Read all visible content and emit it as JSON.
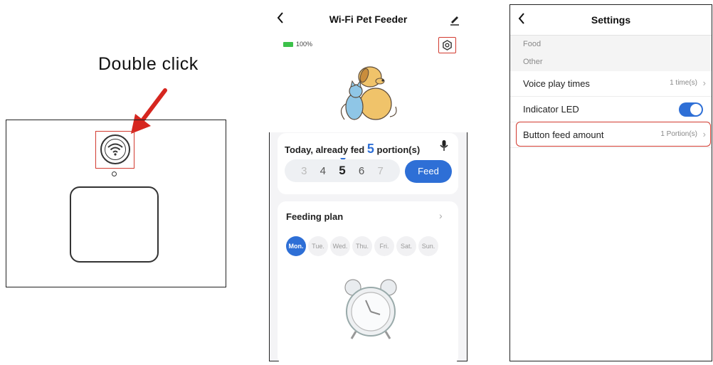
{
  "illustration": {
    "caption": "Double click",
    "arrow_color": "#d6261f",
    "highlight_color": "#d23a2f"
  },
  "feeder_screen": {
    "title": "Wi-Fi Pet Feeder",
    "back_icon": "chevron-left-icon",
    "edit_icon": "pencil-icon",
    "battery_percent": "100%",
    "fed_prefix": "Today, already fed",
    "fed_count": "5",
    "fed_suffix": "portion(s)",
    "portion_options": [
      "3",
      "4",
      "5",
      "6",
      "7"
    ],
    "portion_selected": "5",
    "feed_button": "Feed",
    "plan_title": "Feeding plan",
    "days": [
      "Mon.",
      "Tue.",
      "Wed.",
      "Thu.",
      "Fri.",
      "Sat.",
      "Sun."
    ],
    "day_selected": "Mon.",
    "accent_color": "#2e6fd6"
  },
  "settings_screen": {
    "title": "Settings",
    "sections": {
      "food": "Food",
      "other": "Other"
    },
    "rows": [
      {
        "label": "Voice play times",
        "value": "1 time(s)"
      },
      {
        "label": "Indicator LED",
        "toggle_on": true
      },
      {
        "label": "Button feed amount",
        "value": "1 Portion(s)"
      }
    ]
  }
}
